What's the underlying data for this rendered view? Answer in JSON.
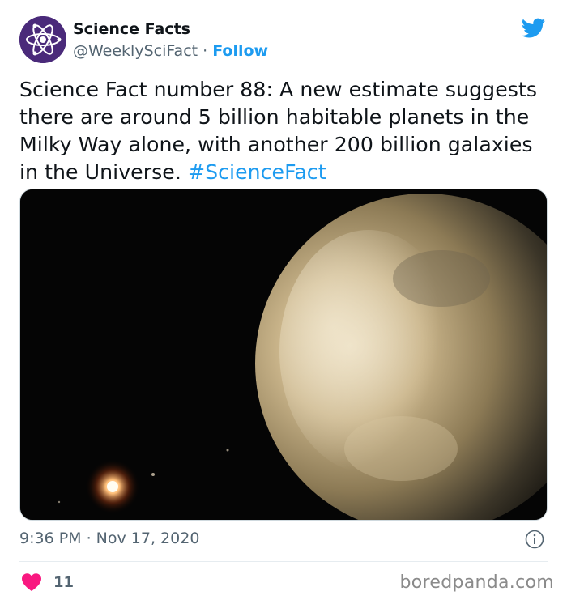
{
  "header": {
    "name": "Science Facts",
    "handle": "@WeeklySciFact",
    "separator": " · ",
    "follow_label": "Follow"
  },
  "tweet": {
    "text": "Science Fact number 88: A new estimate suggests there are around 5 billion habitable planets in the Milky Way alone, with another 200 billion galaxies in the Universe. ",
    "hashtag": "#ScienceFact"
  },
  "timestamp": "9:36 PM · Nov 17, 2020",
  "likes": {
    "count": "11"
  },
  "watermark": "boredpanda.com",
  "colors": {
    "accent": "#1d9bf0",
    "like": "#f91880",
    "avatar": "#4a2a7a"
  },
  "icons": [
    "atom-avatar-icon",
    "twitter-bird-icon",
    "info-icon",
    "heart-icon"
  ]
}
